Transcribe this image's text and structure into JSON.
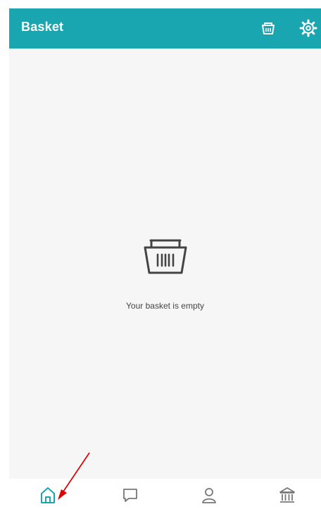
{
  "header": {
    "title": "Basket",
    "basket_icon": "basket-icon",
    "settings_icon": "gear-icon"
  },
  "empty_state": {
    "icon": "basket-icon",
    "message": "Your basket is empty"
  },
  "tabbar": {
    "items": [
      {
        "name": "home",
        "icon": "home-icon",
        "active": true
      },
      {
        "name": "messages",
        "icon": "chat-bubble-icon",
        "active": false
      },
      {
        "name": "profile",
        "icon": "person-icon",
        "active": false
      },
      {
        "name": "bank",
        "icon": "bank-icon",
        "active": false
      }
    ]
  },
  "colors": {
    "header_bg": "#1aa6b0",
    "active_tab": "#1aa6b0",
    "inactive_tab": "#777777",
    "annotation_arrow": "#e00000"
  }
}
